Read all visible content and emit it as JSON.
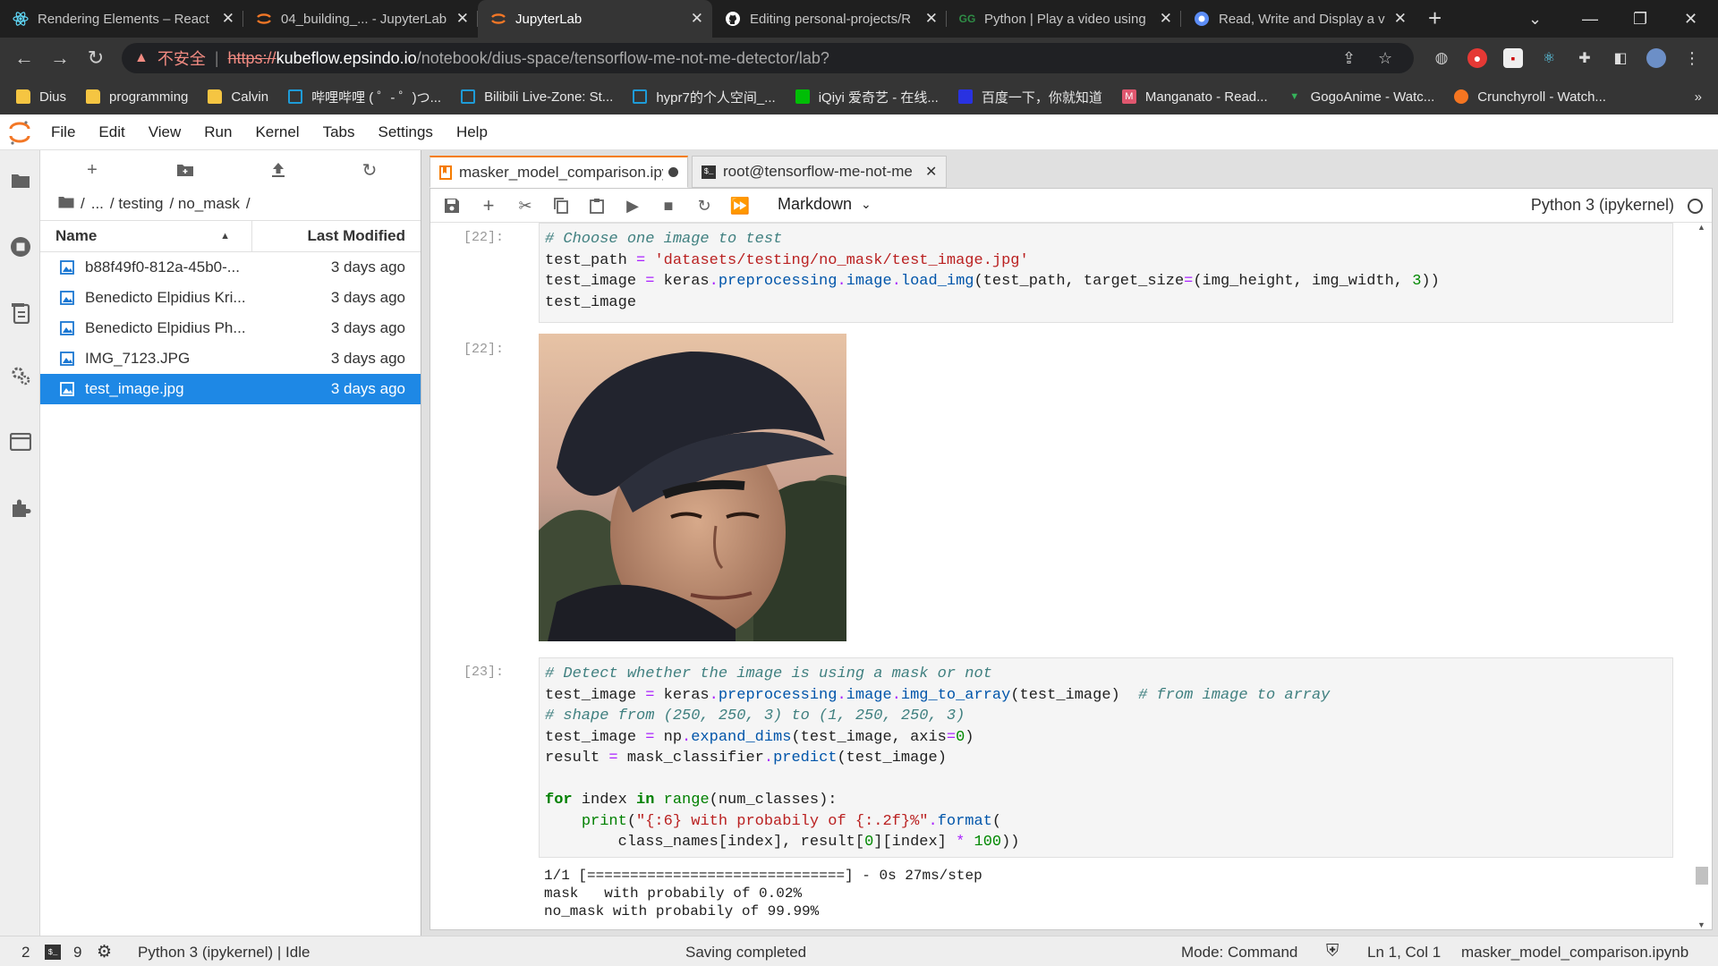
{
  "browser": {
    "tabs": [
      {
        "title": "Rendering Elements – React",
        "icon": "react-icon",
        "color": "#61dafb"
      },
      {
        "title": "04_building_... - JupyterLab",
        "icon": "jupyter-icon",
        "color": "#f37726"
      },
      {
        "title": "JupyterLab",
        "icon": "jupyter-icon",
        "color": "#f37726"
      },
      {
        "title": "Editing personal-projects/R",
        "icon": "github-icon",
        "color": "#ffffff"
      },
      {
        "title": "Python | Play a video using",
        "icon": "geeksforgeeks-icon",
        "color": "#2f8d46"
      },
      {
        "title": "Read, Write and Display a v",
        "icon": "opencv-icon",
        "color": "#5c8df6"
      }
    ],
    "active_tab_index": 2,
    "security_label": "不安全",
    "url": {
      "scheme": "https://",
      "host": "kubeflow.epsindo.io",
      "path": "/notebook/dius-space/tensorflow-me-not-me-detector/lab?"
    },
    "bookmarks": [
      {
        "label": "Dius",
        "type": "folder"
      },
      {
        "label": "programming",
        "type": "folder"
      },
      {
        "label": "Calvin",
        "type": "folder"
      },
      {
        "label": "哔哩哔哩 ( ゜- ゜)つ...",
        "type": "bilibili"
      },
      {
        "label": "Bilibili Live-Zone: St...",
        "type": "bilibili"
      },
      {
        "label": "hypr7的个人空间_...",
        "type": "bilibili"
      },
      {
        "label": "iQiyi 爱奇艺 - 在线...",
        "type": "iqiyi"
      },
      {
        "label": "百度一下，你就知道",
        "type": "baidu"
      },
      {
        "label": "Manganato - Read...",
        "type": "manganato"
      },
      {
        "label": "GogoAnime - Watc...",
        "type": "gogoanime"
      },
      {
        "label": "Crunchyroll - Watch...",
        "type": "crunchyroll"
      }
    ]
  },
  "menubar": {
    "items": [
      "File",
      "Edit",
      "View",
      "Run",
      "Kernel",
      "Tabs",
      "Settings",
      "Help"
    ]
  },
  "filebrowser": {
    "breadcrumb": [
      "/",
      "...",
      "/ testing",
      "/ no_mask",
      "/"
    ],
    "col_name": "Name",
    "col_modified": "Last Modified",
    "files": [
      {
        "name": "b88f49f0-812a-45b0-...",
        "modified": "3 days ago"
      },
      {
        "name": "Benedicto Elpidius Kri...",
        "modified": "3 days ago"
      },
      {
        "name": "Benedicto Elpidius Ph...",
        "modified": "3 days ago"
      },
      {
        "name": "IMG_7123.JPG",
        "modified": "3 days ago"
      },
      {
        "name": "test_image.jpg",
        "modified": "3 days ago"
      }
    ],
    "selected_index": 4
  },
  "notebook": {
    "tabs": [
      {
        "title": "masker_model_comparison.ipynb",
        "dirty": true
      },
      {
        "title": "root@tensorflow-me-not-me",
        "dirty": false
      }
    ],
    "cell_type": "Markdown",
    "kernel": "Python 3 (ipykernel)",
    "cells": [
      {
        "prompt": "[22]:"
      },
      {
        "prompt": "[22]:"
      },
      {
        "prompt": "[23]:"
      }
    ],
    "output_lines": [
      "1/1 [==============================] - 0s 27ms/step",
      "mask   with probabily of 0.02%",
      "no_mask with probabily of 99.99%"
    ]
  },
  "statusbar": {
    "terminals": "2",
    "kernels": "9",
    "kernel_status": "Python 3 (ipykernel) | Idle",
    "message": "Saving completed",
    "mode": "Mode: Command",
    "position": "Ln 1, Col 1",
    "filename": "masker_model_comparison.ipynb"
  },
  "colors": {
    "accent": "#f57c00",
    "selection": "#1e88e5",
    "chrome_dark": "#1f1f1f"
  }
}
